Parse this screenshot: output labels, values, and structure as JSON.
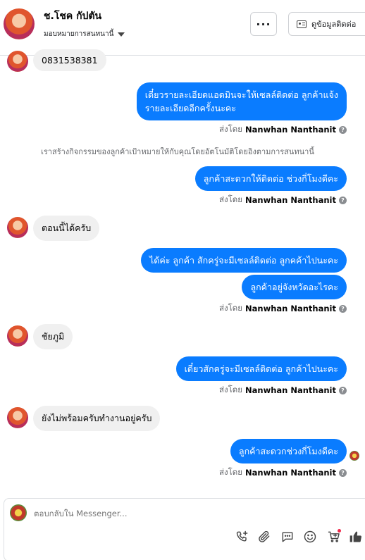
{
  "header": {
    "contact_name": "ช.โชค กัปตัน",
    "assign_label": "มอบหมายการสนทนานี้",
    "more_label": "···",
    "contact_info_label": "ดูข้อมูลติดต่อ"
  },
  "conversation": {
    "messages": [
      {
        "dir": "in",
        "text": "0831538381"
      },
      {
        "dir": "out",
        "lines": [
          "เดี๋ยวรายละเอียดแอดมินจะให้เซลล์ติดต่อ ลูกค้าแจ้ง",
          "รายละเอียดอีกครั้งนะคะ"
        ]
      },
      {
        "dir": "out",
        "text": "ลูกค้าสะดวกให้ติดต่อ ช่วงกี่โมงดีคะ"
      },
      {
        "dir": "in",
        "text": "ตอนนี้ได้ครับ"
      },
      {
        "dir": "out",
        "text": "ได้ค่ะ ลูกค้า สักครู่จะมีเซลล์ติดต่อ ลูกคค้าไปนะคะ"
      },
      {
        "dir": "out",
        "text": "ลูกค้าอยู่จังหวัดอะไรคะ"
      },
      {
        "dir": "in",
        "text": "ชัยภูมิ"
      },
      {
        "dir": "out",
        "text": "เดี๋ยวสักครู่จะมีเซลล์ติดต่อ ลูกค้าไปนะคะ"
      },
      {
        "dir": "in",
        "text": "ยังไม่พร้อมครับทำงานอยู่ครับ"
      },
      {
        "dir": "out",
        "text": "ลูกค้าสะดวกช่วงกี่โมงดีคะ"
      }
    ],
    "sent_by_prefix": "ส่งโดย",
    "sent_by_name": "Nanwhan Nanthanit",
    "help_glyph": "?",
    "system_note": "เราสร้างกิจกรรมของลูกค้าเป้าหมายให้กับคุณโดยอัตโนมัติโดยอิงตามการสนทนานี้"
  },
  "composer": {
    "placeholder": "ตอบกลับใน Messenger..."
  },
  "toolbar": {
    "icons": [
      "phone-plus-icon",
      "attachment-icon",
      "saved-replies-icon",
      "emoji-icon",
      "cart-icon",
      "like-icon"
    ]
  },
  "colors": {
    "outgoing_bubble": "#0a7cff",
    "incoming_bubble": "#f0f0f0",
    "like_icon": "#444444",
    "cart_badge": "#f0284a"
  }
}
